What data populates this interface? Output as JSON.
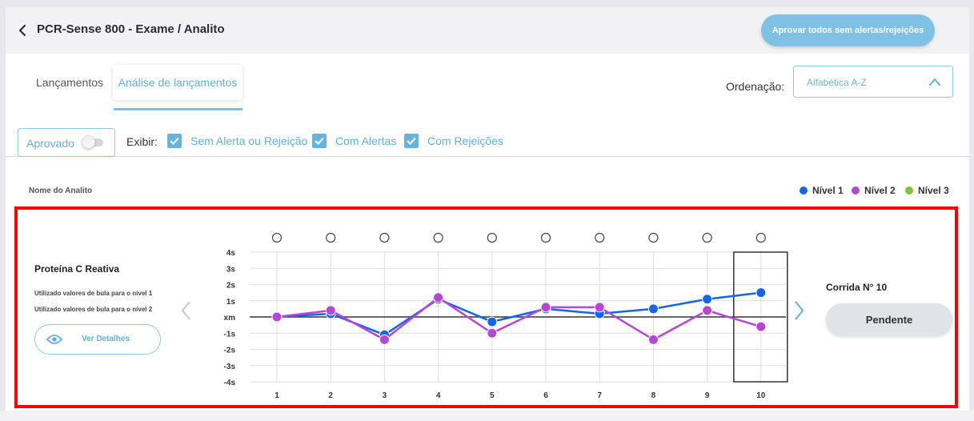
{
  "header": {
    "title": "PCR-Sense 800 - Exame / Analito",
    "approve_all_label": "Aprovar todos sem alertas/rejeições"
  },
  "tabs": [
    {
      "label": "Lançamentos",
      "active": false
    },
    {
      "label": "Análise de lançamentos",
      "active": true
    }
  ],
  "ordering": {
    "label": "Ordenação:",
    "value": "Alfabética A-Z"
  },
  "filters": {
    "approved_label": "Aprovado",
    "approved_on": false,
    "show_label": "Exibir:",
    "checkboxes": [
      {
        "label": "Sem Alerta ou Rejeição",
        "checked": true
      },
      {
        "label": "Com Alertas",
        "checked": true
      },
      {
        "label": "Com Rejeições",
        "checked": true
      }
    ]
  },
  "section": {
    "label": "Nome do Analito"
  },
  "legend": [
    {
      "label": "Nível 1",
      "color": "#1565e8"
    },
    {
      "label": "Nível 2",
      "color": "#b646d6"
    },
    {
      "label": "Nível 3",
      "color": "#7cc43a"
    }
  ],
  "analyte": {
    "name": "Proteína C Reativa",
    "notes": [
      "Utilizado valores de bula para o nível 1",
      "Utilizado valores de bula para o nível 2"
    ],
    "details_label": "Ver Detalhes",
    "run_label": "Corrida N° 10",
    "status_label": "Pendente"
  },
  "colors": {
    "accent": "#5fb0dd",
    "highlight_border": "#ff0000"
  },
  "chart_data": {
    "type": "line",
    "x": [
      1,
      2,
      3,
      4,
      5,
      6,
      7,
      8,
      9,
      10
    ],
    "y_ticks": [
      "4s",
      "3s",
      "2s",
      "1s",
      "xm",
      "-1s",
      "-2s",
      "-3s",
      "-4s"
    ],
    "ylim": [
      -4,
      4
    ],
    "grid": true,
    "selected_run": 10,
    "series": [
      {
        "name": "Nível 1",
        "color": "#1565e8",
        "values": [
          0,
          0.2,
          -1.1,
          1.1,
          -0.3,
          0.5,
          0.2,
          0.5,
          1.1,
          1.5
        ]
      },
      {
        "name": "Nível 2",
        "color": "#b646d6",
        "values": [
          0,
          0.4,
          -1.4,
          1.2,
          -1.0,
          0.6,
          0.6,
          -1.4,
          0.4,
          -0.6
        ]
      }
    ]
  }
}
